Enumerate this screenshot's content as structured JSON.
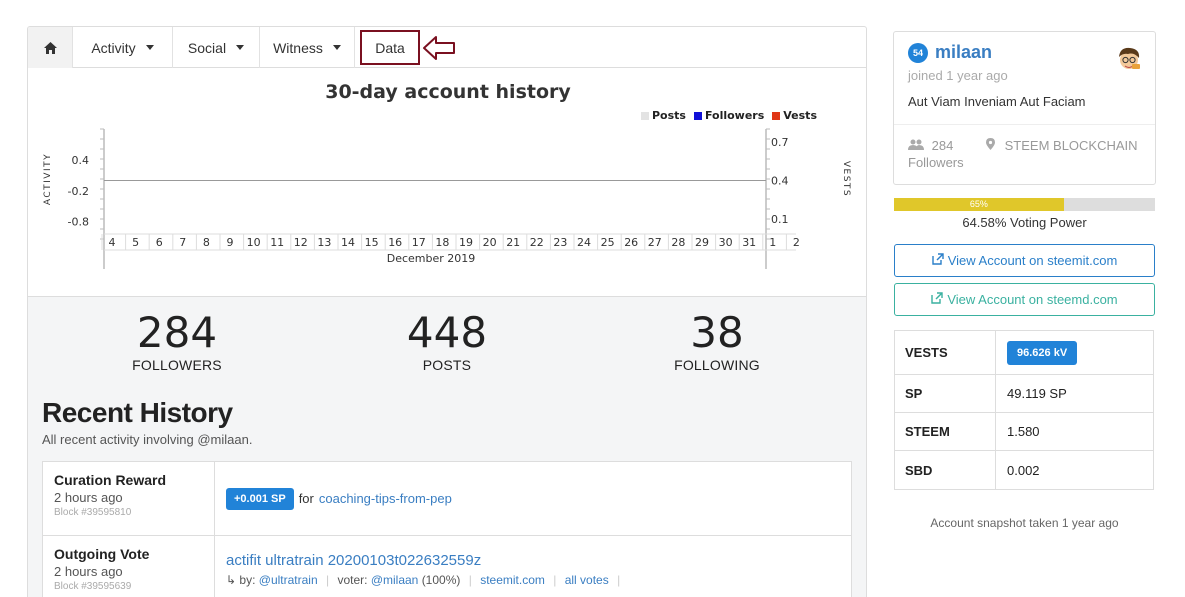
{
  "tabs": {
    "activity": "Activity",
    "social": "Social",
    "witness": "Witness",
    "data": "Data"
  },
  "chart": {
    "legend": [
      {
        "label": "Posts",
        "color": "#e3e3e3"
      },
      {
        "label": "Followers",
        "color": "#1010d8"
      },
      {
        "label": "Vests",
        "color": "#e03616"
      }
    ]
  },
  "chart_data": {
    "type": "line",
    "title": "30-day account history",
    "xlabel": "December 2019",
    "ylabel": "ACTIVITY",
    "y2label": "VESTS",
    "x": [
      "4",
      "5",
      "6",
      "7",
      "8",
      "9",
      "10",
      "11",
      "12",
      "13",
      "14",
      "15",
      "16",
      "17",
      "18",
      "19",
      "20",
      "21",
      "22",
      "23",
      "24",
      "25",
      "26",
      "27",
      "28",
      "29",
      "30",
      "31",
      "1",
      "2"
    ],
    "y_ticks": [
      "0.4",
      "-0.2",
      "-0.8"
    ],
    "y2_ticks": [
      "0.7",
      "0.4",
      "0.1"
    ],
    "ylim": [
      -1.0,
      1.0
    ],
    "y2lim": [
      0.0,
      0.8
    ],
    "series": [
      {
        "name": "Posts",
        "values": [
          0,
          0,
          0,
          0,
          0,
          0,
          0,
          0,
          0,
          0,
          0,
          0,
          0,
          0,
          0,
          0,
          0,
          0,
          0,
          0,
          0,
          0,
          0,
          0,
          0,
          0,
          0,
          0,
          0,
          0
        ]
      },
      {
        "name": "Followers",
        "values": [
          0,
          0,
          0,
          0,
          0,
          0,
          0,
          0,
          0,
          0,
          0,
          0,
          0,
          0,
          0,
          0,
          0,
          0,
          0,
          0,
          0,
          0,
          0,
          0,
          0,
          0,
          0,
          0,
          0,
          0
        ]
      },
      {
        "name": "Vests",
        "values": [
          0,
          0,
          0,
          0,
          0,
          0,
          0,
          0,
          0,
          0,
          0,
          0,
          0,
          0,
          0,
          0,
          0,
          0,
          0,
          0,
          0,
          0,
          0,
          0,
          0,
          0,
          0,
          0,
          0,
          0
        ]
      }
    ],
    "legend_position": "top-right"
  },
  "stats": {
    "followers": {
      "value": "284",
      "label": "FOLLOWERS"
    },
    "posts": {
      "value": "448",
      "label": "POSTS"
    },
    "following": {
      "value": "38",
      "label": "FOLLOWING"
    }
  },
  "recent_history": {
    "title": "Recent History",
    "subtitle": "All recent activity involving @milaan.",
    "rows": [
      {
        "type": "Curation Reward",
        "time": "2 hours ago",
        "block": "Block #39595810",
        "badge": "+0.001 SP",
        "for_text": "for",
        "link": "coaching-tips-from-pep"
      },
      {
        "type": "Outgoing Vote",
        "time": "2 hours ago",
        "block": "Block #39595639",
        "title": "actifit ultratrain 20200103t022632559z",
        "by_prefix": "by:",
        "by_user": "@ultratrain",
        "voter_prefix": "voter:",
        "voter_user": "@milaan",
        "voter_pct": "(100%)",
        "link1": "steemit.com",
        "link2": "all votes"
      }
    ]
  },
  "profile": {
    "reputation": "54",
    "username": "milaan",
    "joined": "joined 1 year ago",
    "motto": "Aut Viam Inveniam Aut Faciam",
    "followers_count": "284",
    "followers_label": "Followers",
    "location": "STEEM BLOCKCHAIN"
  },
  "voting_power": {
    "percent": 65,
    "bar_label": "65%",
    "text": "64.58% Voting Power"
  },
  "buttons": {
    "steemit": "View Account on steemit.com",
    "steemd": "View Account on steemd.com"
  },
  "balances": [
    {
      "key": "VESTS",
      "value": "96.626 kV"
    },
    {
      "key": "SP",
      "value": "49.119 SP"
    },
    {
      "key": "STEEM",
      "value": "1.580"
    },
    {
      "key": "SBD",
      "value": "0.002"
    }
  ],
  "snapshot": "Account snapshot taken 1 year ago"
}
